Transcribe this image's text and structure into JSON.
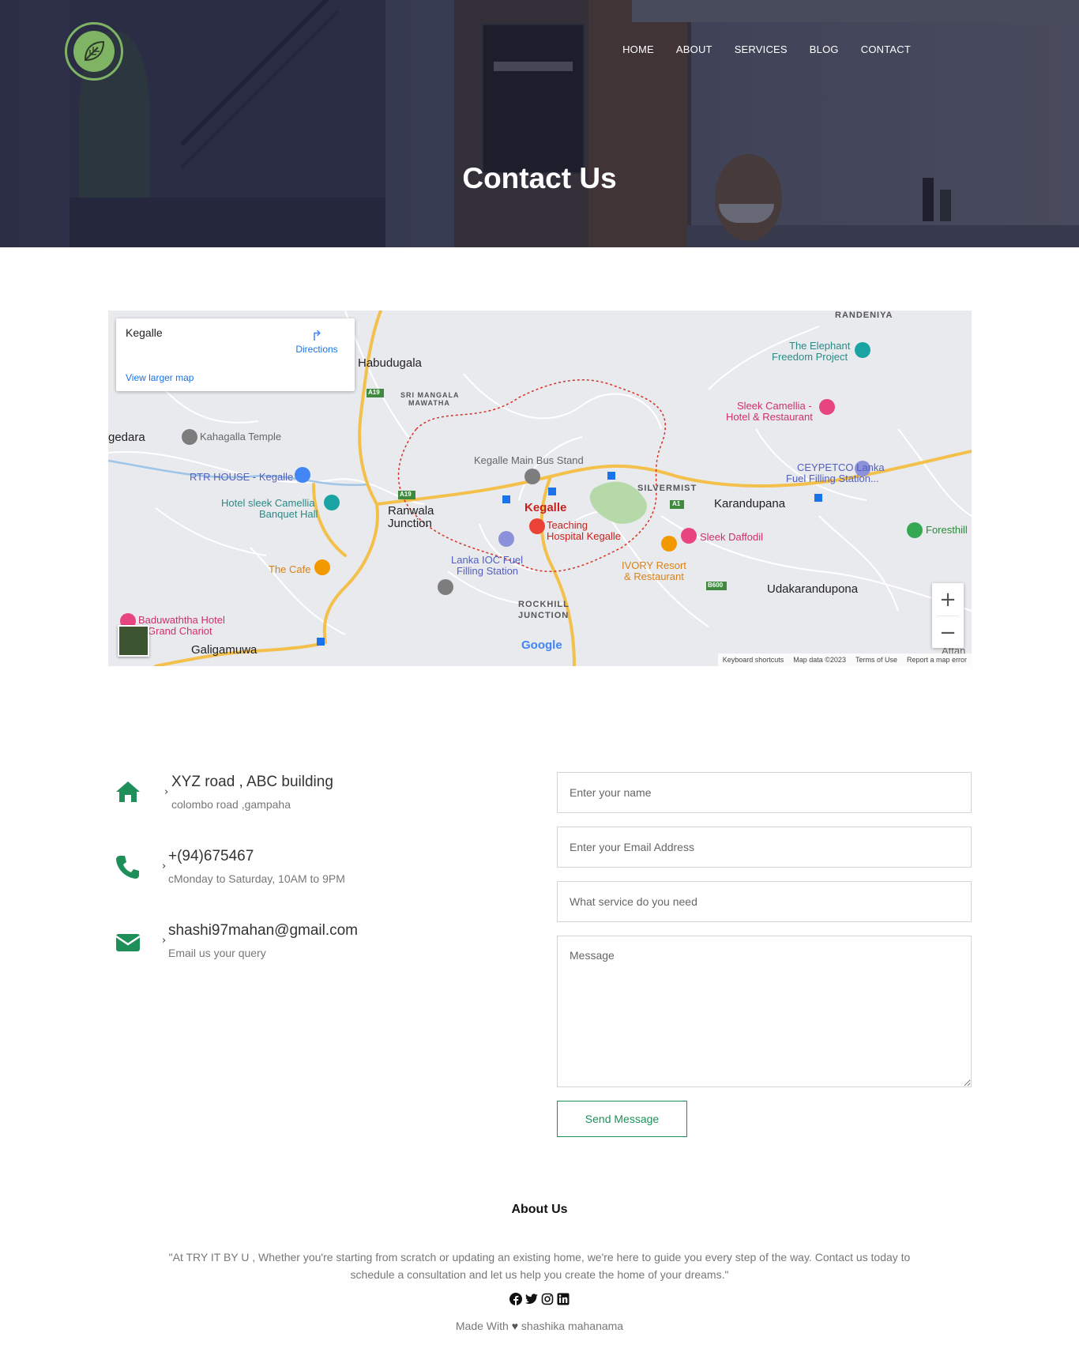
{
  "nav": {
    "items": [
      "HOME",
      "ABOUT",
      "SERVICES",
      "BLOG",
      "CONTACT"
    ]
  },
  "hero": {
    "title": "Contact Us"
  },
  "map": {
    "place_name": "Kegalle",
    "directions_label": "Directions",
    "view_larger_label": "View larger map",
    "labels": {
      "habudugala": "Habudugala",
      "sri_mangala": "SRI MANGALA",
      "mawatha": "MAWATHA",
      "randeniya": "RANDENIYA",
      "elephant1": "The Elephant",
      "elephant2": "Freedom Project",
      "sleek1": "Sleek Camellia -",
      "sleek2": "Hotel & Restaurant",
      "gedara": "gedara",
      "kahagalla": "Kahagalla Temple",
      "bus_stand": "Kegalle Main Bus Stand",
      "ceypetco1": "CEYPETCO Lanka",
      "ceypetco2": "Fuel Filling Station...",
      "rtr": "RTR HOUSE - Kegalle",
      "silvermist": "SILVERMIST",
      "hotel_sleek1": "Hotel sleek Camellia",
      "hotel_sleek2": "Banquet Hall",
      "ranwala1": "Ranwala",
      "ranwala2": "Junction",
      "kegalle": "Kegalle",
      "karandupana": "Karandupana",
      "foresthill": "Foresthill",
      "teaching1": "Teaching",
      "teaching2": "Hospital Kegalle",
      "sleek_daffodil": "Sleek Daffodil",
      "lanka_ioc1": "Lanka IOC Fuel",
      "lanka_ioc2": "Filling Station",
      "the_cafe": "The Cafe",
      "ivory1": "IVORY Resort",
      "ivory2": "& Restaurant",
      "udakarandupona": "Udakarandupona",
      "rockhill1": "ROCKHILL",
      "rockhill2": "JUNCTION",
      "baduwaththa1": "Baduwaththa Hotel",
      "baduwaththa2": "Grand Chariot",
      "galigamuwa": "Galigamuwa",
      "attana": "Attan",
      "road_a19a": "A19",
      "road_a19b": "A19",
      "road_a1": "A1",
      "road_b600": "B600"
    },
    "google": "Google",
    "attribution": [
      "Keyboard shortcuts",
      "Map data ©2023",
      "Terms of Use",
      "Report a map error"
    ]
  },
  "contact": {
    "address_main": "XYZ road , ABC building",
    "address_sub": "colombo road ,gampaha",
    "phone_main": "+(94)675467",
    "phone_sub": "cMonday to Saturday, 10AM to 9PM",
    "email_main": "shashi97mahan@gmail.com",
    "email_sub": "Email us your query",
    "chevron": "›"
  },
  "form": {
    "name_placeholder": "Enter your name",
    "email_placeholder": "Enter your Email Address",
    "service_placeholder": "What service do you need",
    "message_placeholder": "Message",
    "send_label": "Send Message"
  },
  "footer": {
    "title": "About Us",
    "text": "\"At TRY IT BY U , Whether you're starting from scratch or updating an existing home, we're here to guide you every step of the way. Contact us today to schedule a consultation and let us help you create the home of your dreams.\"",
    "made_prefix": "Made With",
    "made_author": "shashika mahanama",
    "social_icons": [
      "facebook-icon",
      "twitter-icon",
      "instagram-icon",
      "linkedin-icon"
    ]
  },
  "colors": {
    "accent_green": "#1f8f5a",
    "logo_green": "#7fb465"
  }
}
